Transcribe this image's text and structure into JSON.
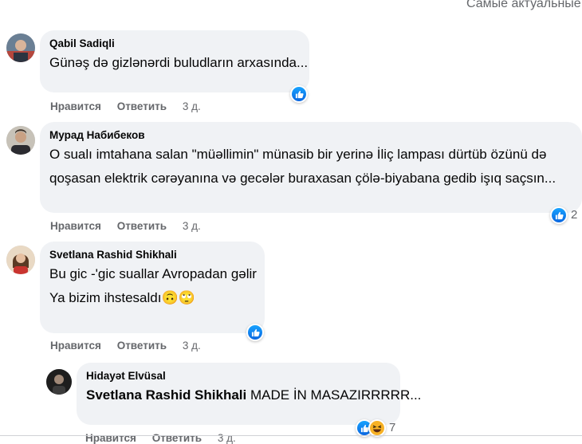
{
  "sort": {
    "label": "Самые актуальные"
  },
  "actions": {
    "like": "Нравится",
    "reply": "Ответить"
  },
  "colors": {
    "bubble": "#f0f2f5",
    "like_blue": "#1877f2",
    "meta_gray": "#65676b"
  },
  "comments": [
    {
      "author": "Qabil Sadiqli",
      "lines": [
        "Günəş də gizlənərdi buludların arxasında..."
      ],
      "time": "3 д.",
      "reactions": [
        "like-icon"
      ]
    },
    {
      "author": "Мурад Набибеков",
      "lines": [
        "O sualı imtahana salan \"müəllimin\" münasib bir yerinə İliç lampası dürtüb özünü də",
        "qoşasan elektrik cərəyanına və gecələr buraxasan çölə-biyabana gedib işıq saçsın..."
      ],
      "time": "3 д.",
      "reactions": [
        "like-icon"
      ],
      "reaction_count": "2"
    },
    {
      "author": "Svetlana Rashid Shikhali",
      "lines": [
        "Bu gic -'gic suallar Avropadan gəlir",
        "Ya bizim ihstesaldı🙃🙄"
      ],
      "time": "3 д.",
      "reactions": [
        "like-icon"
      ]
    }
  ],
  "reply": {
    "author": "Hidayət Elvüsal",
    "mention": "Svetlana Rashid Shikhali",
    "text": "MADE İN MASAZIRRRRR...",
    "reactions": [
      "like-icon",
      "haha-icon"
    ],
    "reaction_count": "7",
    "time": "3 д."
  }
}
